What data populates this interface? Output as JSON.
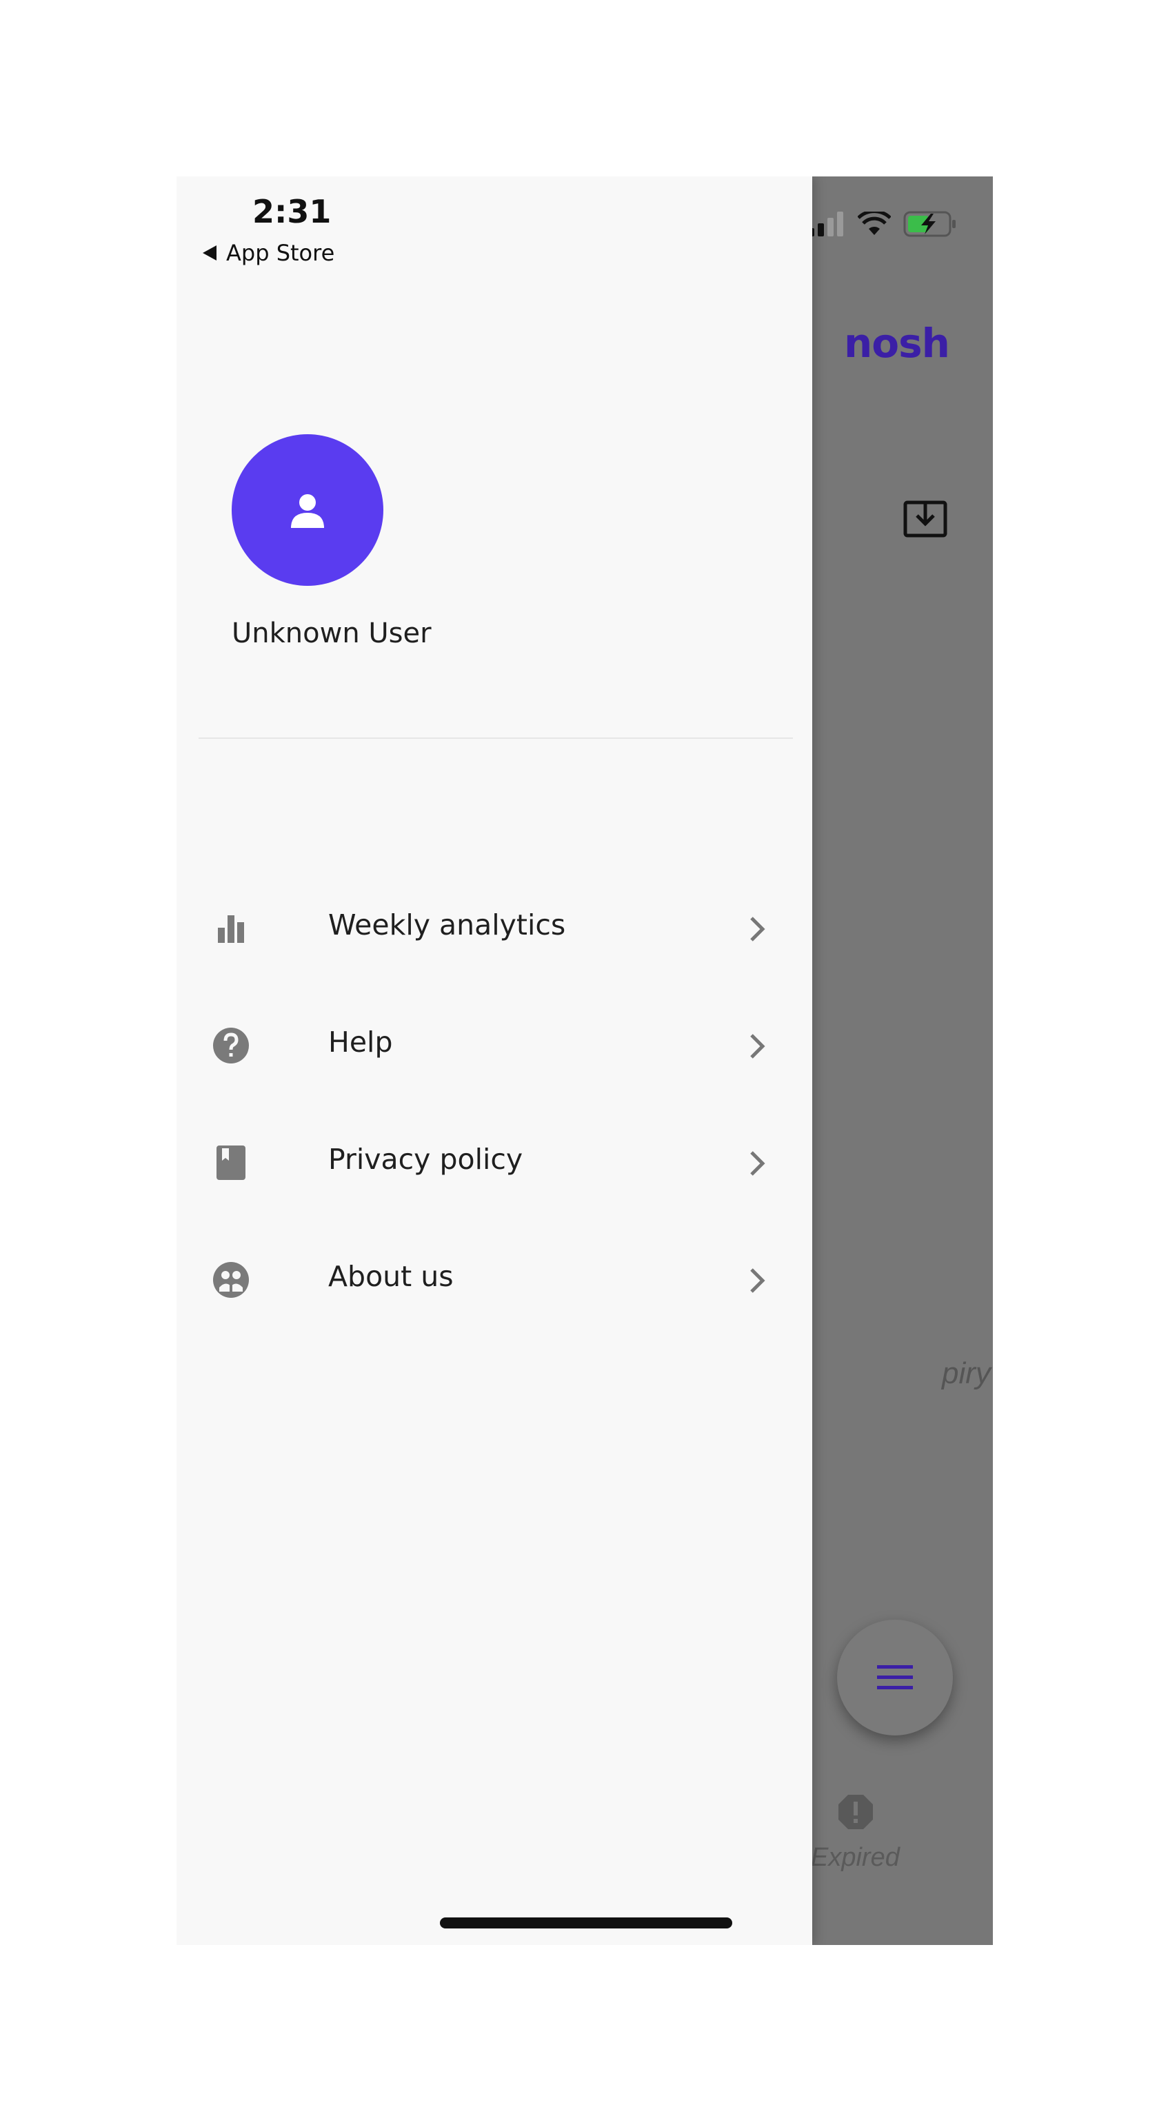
{
  "status_bar": {
    "time": "2:31",
    "back_label": "App Store"
  },
  "background_app": {
    "logo": "nosh",
    "expiry_fragment": "piry",
    "expired_label": "Expired"
  },
  "drawer": {
    "user_name": "Unknown User",
    "menu": [
      {
        "label": "Weekly analytics",
        "icon": "bar-chart-icon"
      },
      {
        "label": "Help",
        "icon": "help-icon"
      },
      {
        "label": "Privacy policy",
        "icon": "book-icon"
      },
      {
        "label": "About us",
        "icon": "people-icon"
      }
    ]
  },
  "colors": {
    "accent": "#5a3cf0",
    "logo": "#3b1fa6",
    "drawer_bg": "#f8f8f8",
    "scrim": "#777777"
  }
}
